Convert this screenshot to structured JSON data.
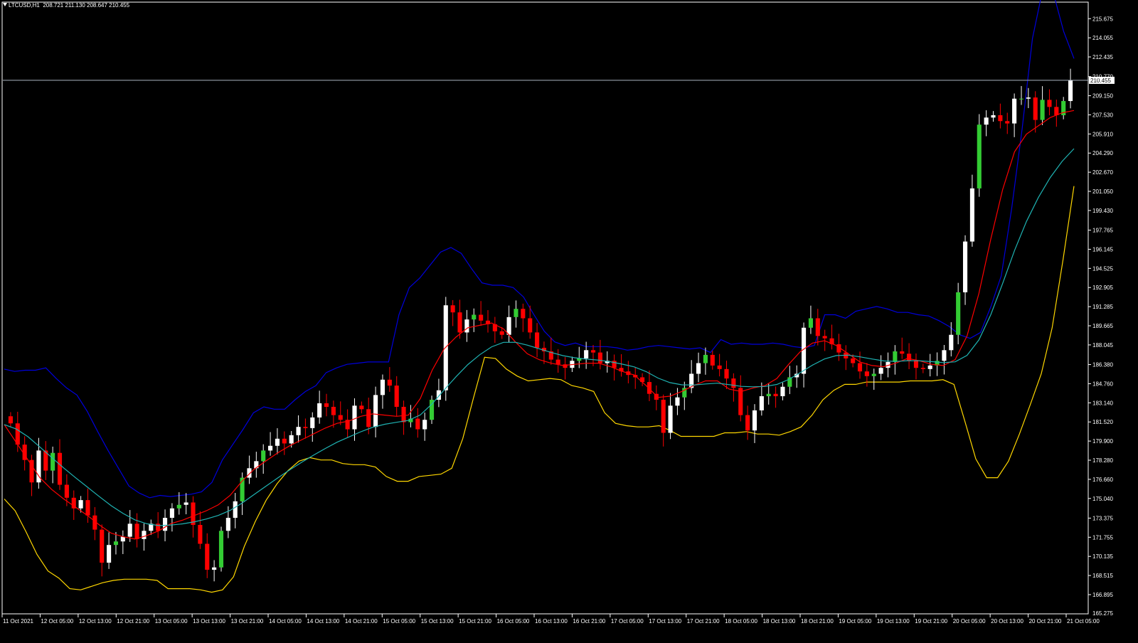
{
  "header": {
    "symbol": "LTCUSD,H1",
    "ohlc": "208.721 211.130 208.647 210.455"
  },
  "colors": {
    "background": "#000000",
    "frame": "#ffffff",
    "bull_candle": "#ffffff",
    "bear_candle": "#ff0000",
    "prev_bull_candle": "#33cc33",
    "ma_fast": "#ff0000",
    "ma_slow": "#1fb3b3",
    "bb_upper": "#0000dd",
    "bb_lower": "#ffd700",
    "bid_line": "#aab4c0"
  },
  "chart_data": {
    "type": "candlestick",
    "symbol": "LTCUSD",
    "timeframe": "H1",
    "current_price": 210.455,
    "y_ticks": [
      166.895,
      168.515,
      170.135,
      171.755,
      173.375,
      175.04,
      176.66,
      178.28,
      179.9,
      181.52,
      183.14,
      184.76,
      186.38,
      188.045,
      189.665,
      191.285,
      192.905,
      194.525,
      196.145,
      197.765,
      199.43,
      201.05,
      202.67,
      204.29,
      205.91,
      207.53,
      209.15,
      210.77,
      212.435,
      214.055,
      215.675
    ],
    "y_tick_labels": [
      "166.895",
      "168.515",
      "170.135",
      "171.755",
      "173.375",
      "175.040",
      "176.660",
      "178.280",
      "179.900",
      "181.520",
      "183.140",
      "184.760",
      "186.380",
      "188.045",
      "189.665",
      "191.285",
      "192.905",
      "194.525",
      "196.145",
      "197.765",
      "199.430",
      "201.050",
      "202.670",
      "204.290",
      "205.910",
      "207.530",
      "209.150",
      "210.770",
      "212.435",
      "214.055",
      "215.675"
    ],
    "bottom_tick_label": "165.275",
    "x_labels": [
      "11 Oct 2021",
      "12 Oct 05:00",
      "12 Oct 13:00",
      "12 Oct 21:00",
      "13 Oct 05:00",
      "13 Oct 13:00",
      "13 Oct 21:00",
      "14 Oct 05:00",
      "14 Oct 13:00",
      "14 Oct 21:00",
      "15 Oct 05:00",
      "15 Oct 13:00",
      "15 Oct 21:00",
      "16 Oct 05:00",
      "16 Oct 13:00",
      "16 Oct 21:00",
      "17 Oct 05:00",
      "17 Oct 13:00",
      "17 Oct 21:00",
      "18 Oct 05:00",
      "18 Oct 13:00",
      "18 Oct 21:00",
      "19 Oct 05:00",
      "19 Oct 13:00",
      "19 Oct 21:00",
      "20 Oct 05:00",
      "20 Oct 13:00",
      "20 Oct 21:00",
      "21 Oct 05:00"
    ],
    "close_series": [
      181.4,
      179.6,
      178.3,
      176.4,
      179.1,
      177.4,
      178.9,
      176.2,
      175.1,
      174.2,
      174.9,
      173.6,
      172.4,
      169.6,
      171.1,
      171.4,
      171.8,
      172.9,
      171.6,
      172.3,
      172.9,
      172.3,
      173.4,
      174.2,
      174.5,
      174.7,
      172.8,
      171.2,
      169.0,
      169.2,
      172.3,
      173.4,
      174.8,
      176.8,
      177.6,
      178.2,
      179.1,
      179.5,
      180.1,
      179.7,
      180.4,
      181.1,
      181.0,
      181.9,
      183.1,
      182.8,
      182.1,
      181.7,
      180.9,
      182.9,
      182.6,
      181.1,
      183.8,
      185.1,
      184.6,
      182.8,
      181.5,
      181.8,
      180.9,
      181.7,
      183.4,
      184.2,
      191.4,
      190.8,
      189.1,
      190.2,
      190.6,
      190.1,
      189.8,
      189.2,
      188.9,
      190.4,
      191.1,
      190.3,
      189.1,
      187.8,
      187.5,
      186.8,
      186.4,
      186.1,
      186.7,
      186.9,
      187.6,
      187.4,
      186.5,
      186.7,
      186.1,
      185.8,
      185.5,
      185.3,
      184.9,
      183.9,
      183.4,
      180.6,
      182.9,
      183.6,
      184.4,
      185.6,
      186.5,
      187.2,
      186.3,
      186.0,
      185.2,
      184.4,
      182.1,
      180.8,
      182.5,
      183.7,
      183.9,
      183.7,
      184.5,
      185.3,
      185.6,
      189.5,
      190.3,
      188.8,
      188.6,
      188.1,
      187.4,
      186.9,
      186.5,
      185.8,
      185.4,
      185.6,
      186.1,
      186.6,
      187.5,
      187.3,
      186.7,
      186.1,
      186.0,
      186.3,
      186.7,
      187.6,
      188.9,
      192.5,
      196.8,
      201.3,
      206.7,
      207.3,
      207.5,
      207.0,
      206.8,
      208.9,
      208.9,
      209.0,
      207.1,
      208.8,
      208.2,
      207.5,
      208.7,
      210.455
    ],
    "bb_upper_series": [
      186.0,
      185.8,
      185.9,
      185.9,
      186.1,
      185.2,
      184.4,
      183.8,
      182.4,
      180.7,
      179.1,
      177.6,
      176.1,
      175.5,
      175.1,
      175.3,
      175.2,
      175.3,
      175.4,
      175.6,
      176.4,
      178.3,
      179.6,
      180.9,
      182.3,
      182.8,
      182.6,
      182.6,
      183.4,
      184.1,
      184.6,
      185.7,
      186.1,
      186.4,
      186.5,
      186.6,
      186.6,
      186.6,
      190.6,
      192.9,
      193.7,
      194.8,
      195.9,
      196.3,
      195.8,
      194.5,
      193.3,
      193.1,
      193.1,
      192.9,
      192.1,
      190.6,
      189.2,
      188.3,
      188.0,
      188.2,
      187.9,
      187.9,
      187.9,
      187.8,
      187.6,
      187.7,
      187.9,
      188.0,
      187.9,
      187.8,
      187.7,
      187.8,
      187.4,
      188.5,
      188.1,
      188.2,
      188.1,
      188.1,
      188.2,
      188.1,
      187.9,
      187.8,
      188.0,
      190.6,
      190.6,
      190.3,
      190.9,
      191.1,
      191.3,
      191.1,
      190.8,
      190.8,
      190.6,
      190.5,
      190.1,
      189.6,
      188.9,
      188.6,
      189.1,
      191.3,
      193.9,
      199.6,
      206.3,
      214.0,
      218.2,
      217.9,
      214.6,
      212.3
    ],
    "bb_lower_series": [
      175.0,
      174.0,
      172.2,
      170.3,
      168.9,
      168.3,
      167.4,
      167.3,
      167.6,
      167.9,
      168.1,
      168.2,
      168.2,
      168.2,
      168.1,
      167.4,
      167.4,
      167.4,
      167.3,
      167.1,
      167.3,
      168.4,
      171.0,
      173.1,
      174.9,
      176.3,
      177.4,
      178.2,
      178.5,
      178.3,
      178.3,
      178.0,
      177.9,
      177.9,
      177.7,
      176.9,
      176.5,
      176.5,
      176.9,
      177.0,
      177.1,
      177.6,
      180.1,
      183.6,
      187.0,
      186.9,
      186.0,
      185.4,
      185.0,
      185.1,
      185.2,
      185.1,
      184.6,
      184.4,
      184.1,
      182.3,
      181.4,
      181.2,
      181.1,
      181.1,
      181.2,
      180.8,
      180.3,
      180.3,
      180.3,
      180.3,
      180.6,
      180.6,
      180.7,
      180.5,
      180.5,
      180.4,
      180.7,
      181.1,
      182.1,
      183.4,
      184.2,
      184.7,
      184.7,
      184.9,
      184.9,
      184.9,
      184.9,
      185.0,
      185.0,
      185.0,
      185.1,
      184.7,
      181.6,
      178.4,
      176.8,
      176.8,
      178.2,
      180.5,
      183.0,
      185.6,
      189.5,
      195.3,
      201.5
    ],
    "ma_fast_series": [
      181.3,
      179.8,
      178.3,
      176.8,
      175.8,
      175.0,
      174.3,
      173.6,
      172.8,
      172.1,
      171.8,
      171.6,
      171.9,
      172.3,
      172.9,
      173.2,
      173.6,
      174.0,
      174.5,
      175.3,
      176.5,
      177.5,
      178.2,
      178.9,
      179.5,
      180.0,
      180.5,
      181.0,
      181.4,
      181.6,
      182.0,
      182.2,
      182.1,
      182.0,
      182.1,
      183.5,
      185.9,
      187.7,
      188.7,
      189.5,
      189.7,
      189.9,
      189.4,
      188.3,
      187.3,
      186.8,
      186.5,
      186.3,
      186.4,
      186.5,
      186.5,
      186.2,
      185.8,
      185.5,
      184.6,
      183.6,
      183.7,
      184.1,
      184.6,
      185.0,
      185.0,
      184.3,
      184.1,
      184.4,
      184.6,
      185.2,
      186.4,
      187.5,
      188.2,
      188.4,
      188.0,
      187.3,
      186.6,
      186.3,
      186.2,
      186.5,
      186.9,
      186.7,
      186.4,
      186.3,
      186.8,
      188.8,
      192.4,
      197.0,
      201.2,
      204.4,
      205.9,
      206.6,
      207.3,
      207.7,
      207.9
    ]
  }
}
